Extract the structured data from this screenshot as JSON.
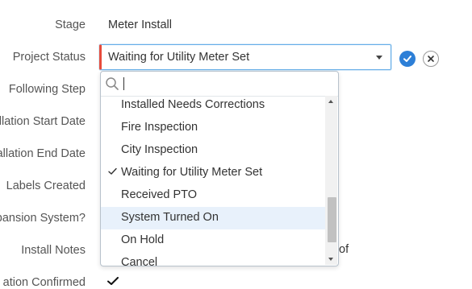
{
  "fields": {
    "stage_label": "Stage",
    "stage_value": "Meter Install",
    "project_status_label": "Project Status",
    "following_step_label": "Following Step",
    "install_start_label": "llation Start Date",
    "install_end_label": "allation End Date",
    "labels_created_label": "Labels Created",
    "expansion_label": "pansion System?",
    "install_notes_label": "Install Notes",
    "confirmed_label": "ation Confirmed",
    "notes_trailing_text": "of"
  },
  "select": {
    "current_value": "Waiting for Utility Meter Set",
    "search_placeholder": "",
    "options": [
      {
        "label": "Installed Needs Corrections",
        "selected": false,
        "hover": false
      },
      {
        "label": "Fire Inspection",
        "selected": false,
        "hover": false
      },
      {
        "label": "City Inspection",
        "selected": false,
        "hover": false
      },
      {
        "label": "Waiting for Utility Meter Set",
        "selected": true,
        "hover": false
      },
      {
        "label": "Received PTO",
        "selected": false,
        "hover": false
      },
      {
        "label": "System Turned On",
        "selected": false,
        "hover": true
      },
      {
        "label": "On Hold",
        "selected": false,
        "hover": false
      },
      {
        "label": "Cancel",
        "selected": false,
        "hover": false
      }
    ]
  },
  "colors": {
    "accent": "#2d7fd7",
    "required_marker": "#e74c3c",
    "hover_bg": "#e8f1fb"
  },
  "icons": {
    "confirm": "check-circle-icon",
    "cancel": "close-circle-icon",
    "search": "search-icon",
    "selected": "checkmark-icon"
  }
}
